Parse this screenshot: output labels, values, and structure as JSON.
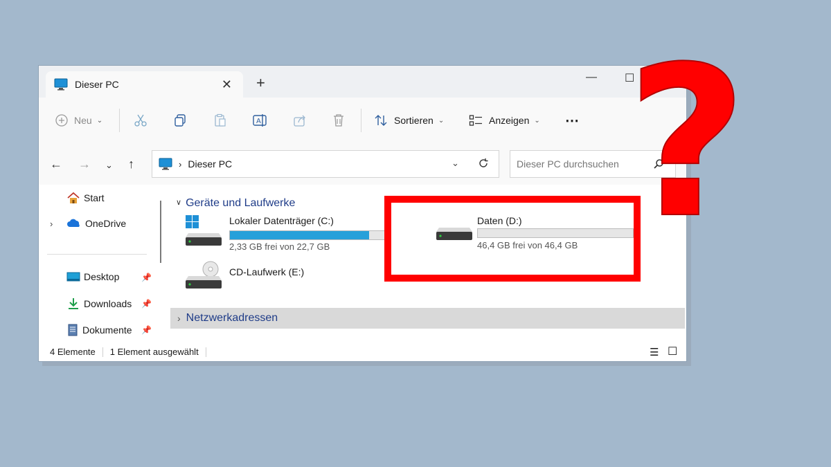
{
  "window": {
    "tab": {
      "title": "Dieser PC"
    },
    "toolbar": {
      "new_label": "Neu",
      "sort_label": "Sortieren",
      "view_label": "Anzeigen"
    },
    "address": {
      "path": "Dieser PC",
      "search_placeholder": "Dieser PC durchsuchen"
    },
    "sidebar": {
      "items": [
        {
          "label": "Start"
        },
        {
          "label": "OneDrive"
        },
        {
          "label": "Desktop"
        },
        {
          "label": "Downloads"
        },
        {
          "label": "Dokumente"
        }
      ]
    },
    "content": {
      "group_devices": "Geräte und Laufwerke",
      "drives": [
        {
          "name": "Lokaler Datenträger (C:)",
          "free_text": "2,33 GB frei von 22,7 GB",
          "used_fraction": 0.897
        },
        {
          "name": "Daten (D:)",
          "free_text": "46,4 GB frei von 46,4 GB",
          "used_fraction": 0.0
        },
        {
          "name": "CD-Laufwerk (E:)"
        }
      ],
      "group_network": "Netzwerkadressen"
    },
    "status": {
      "count": "4 Elemente",
      "selected": "1 Element ausgewählt"
    }
  },
  "colors": {
    "background": "#a3b8cc",
    "accent_bar": "#26a0da",
    "highlight": "#ff0000",
    "group_header": "#1f3c88"
  },
  "annotations": {
    "highlight_target": "Daten (D:)",
    "symbol": "?"
  }
}
